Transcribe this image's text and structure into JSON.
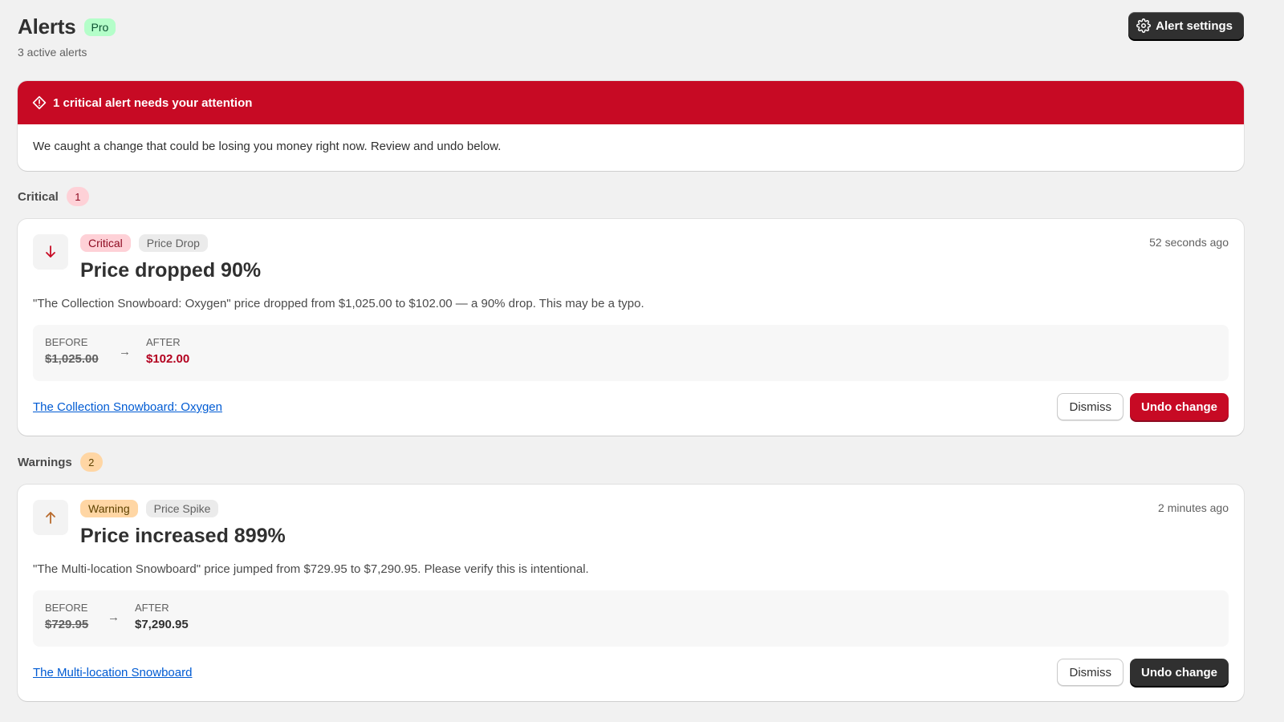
{
  "header": {
    "title": "Alerts",
    "plan_badge": "Pro",
    "subtitle": "3 active alerts",
    "settings_label": "Alert settings"
  },
  "banner": {
    "title": "1 critical alert needs your attention",
    "message": "We caught a change that could be losing you money right now. Review and undo below."
  },
  "sections": {
    "critical": {
      "label": "Critical",
      "count": "1"
    },
    "warnings": {
      "label": "Warnings",
      "count": "2"
    }
  },
  "alerts": [
    {
      "severity": "Critical",
      "type": "Price Drop",
      "direction_icon": "arrow-down-icon",
      "title": "Price dropped 90%",
      "timestamp": "52 seconds ago",
      "description": "\"The Collection Snowboard: Oxygen\" price dropped from $1,025.00 to $102.00 — a 90% drop. This may be a typo.",
      "before_label": "BEFORE",
      "before_value": "$1,025.00",
      "after_label": "AFTER",
      "after_value": "$102.00",
      "arrow": "→",
      "product_link": "The Collection Snowboard: Oxygen",
      "dismiss_label": "Dismiss",
      "undo_label": "Undo change"
    },
    {
      "severity": "Warning",
      "type": "Price Spike",
      "direction_icon": "arrow-up-icon",
      "title": "Price increased 899%",
      "timestamp": "2 minutes ago",
      "description": "\"The Multi-location Snowboard\" price jumped from $729.95 to $7,290.95. Please verify this is intentional.",
      "before_label": "BEFORE",
      "before_value": "$729.95",
      "after_label": "AFTER",
      "after_value": "$7,290.95",
      "arrow": "→",
      "product_link": "The Multi-location Snowboard",
      "dismiss_label": "Dismiss",
      "undo_label": "Undo change"
    }
  ],
  "colors": {
    "critical": "#c70a24",
    "warning_arrow": "#b86a2c",
    "link": "#005bd3",
    "after_critical": "#b3001f",
    "after_warning": "#303030"
  }
}
